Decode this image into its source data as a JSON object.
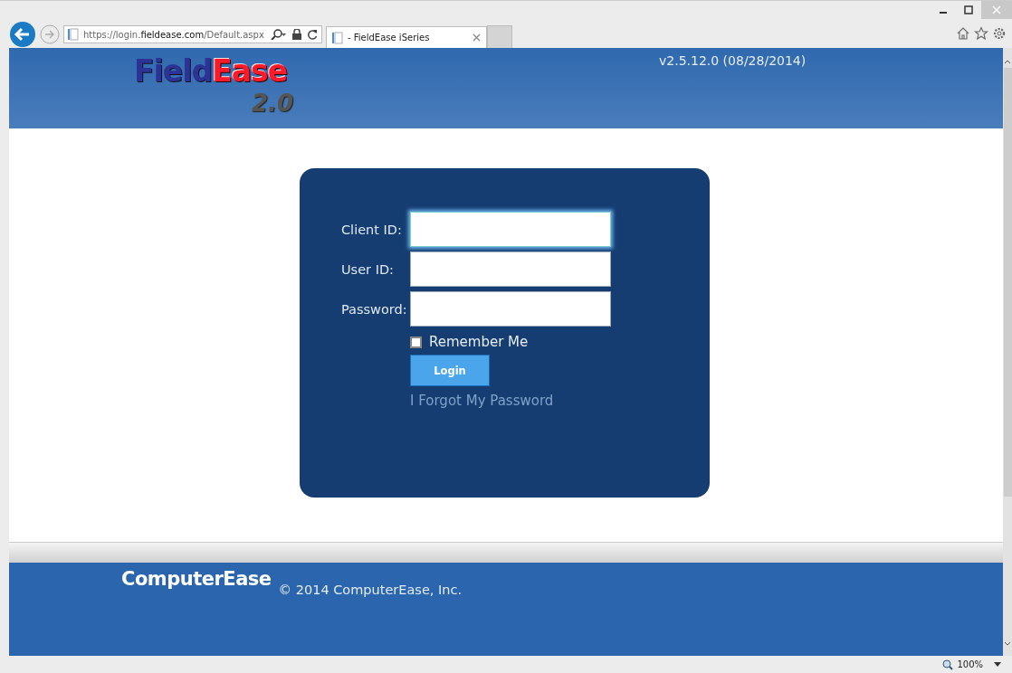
{
  "browser": {
    "address": "https://login.**fieldease.com**/Default.aspx",
    "tab_title": "- FieldEase iSeries",
    "zoom": "100%"
  },
  "header": {
    "logo_first": "Field",
    "logo_second": "Ease",
    "logo_version": "2.0",
    "version": "v2.5.12.0 (08/28/2014)"
  },
  "form": {
    "fields": [
      {
        "label": "Client ID:",
        "focused": true
      },
      {
        "label": "User ID:",
        "focused": false
      },
      {
        "label": "Password:",
        "focused": false
      }
    ],
    "remember": {
      "label": "Remember Me",
      "checked": false
    },
    "login_button": "Login",
    "forgot_link": "I Forgot My Password"
  },
  "footer": {
    "brand": "ComputerEase",
    "copyright": "© 2014 ComputerEase, Inc."
  }
}
